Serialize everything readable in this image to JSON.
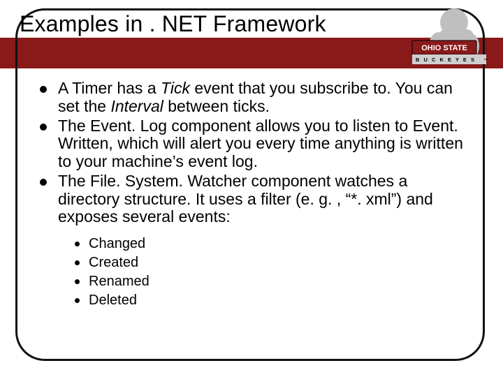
{
  "title": "Examples in . NET Framework",
  "logo": {
    "top_text": "OHIO STATE",
    "bottom_text": "B U C K E Y E S",
    "caption": "™"
  },
  "bullets": [
    {
      "segments": [
        {
          "text": "A Timer has a "
        },
        {
          "text": "Tick",
          "italic": true
        },
        {
          "text": " event that you subscribe to. You can set the "
        },
        {
          "text": "Interval",
          "italic": true
        },
        {
          "text": " between ticks."
        }
      ]
    },
    {
      "segments": [
        {
          "text": "The Event. Log component allows you to listen to Event. Written, which will alert you every time anything is written to your machine’s event log."
        }
      ]
    },
    {
      "segments": [
        {
          "text": "The File. System. Watcher component watches a directory structure. It uses a filter (e. g. , “*. xml”) and exposes several events:"
        }
      ]
    }
  ],
  "sub_bullets": [
    "Changed",
    "Created",
    "Renamed",
    "Deleted"
  ],
  "colors": {
    "brand_red": "#8a1a1a",
    "frame_black": "#111111"
  }
}
